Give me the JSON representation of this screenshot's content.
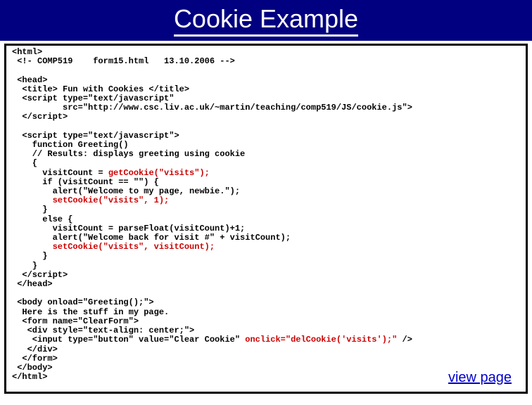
{
  "title": "Cookie Example",
  "link": "view page",
  "code": {
    "l1": "<html>",
    "l2": " <!- COMP519    form15.html   13.10.2006 -->",
    "l3": "",
    "l4": " <head>",
    "l5": "  <title> Fun with Cookies </title>",
    "l6": "  <script type=\"text/javascript\"",
    "l7": "          src=\"http://www.csc.liv.ac.uk/~martin/teaching/comp519/JS/cookie.js\">",
    "l8": "  </script>",
    "l9": "",
    "l10": "  <script type=\"text/javascript\">",
    "l11": "    function Greeting()",
    "l12": "    // Results: displays greeting using cookie",
    "l13": "    {",
    "l14": "      visitCount = ",
    "l14r": "getCookie(\"visits\");",
    "l15": "      if (visitCount == \"\") {",
    "l16": "        alert(\"Welcome to my page, newbie.\");",
    "l17a": "        ",
    "l17r": "setCookie(\"visits\", 1);",
    "l18": "      }",
    "l19": "      else {",
    "l20": "        visitCount = parseFloat(visitCount)+1;",
    "l21": "        alert(\"Welcome back for visit #\" + visitCount);",
    "l22a": "        ",
    "l22r": "setCookie(\"visits\", visitCount);",
    "l23": "      }",
    "l24": "    }",
    "l25": "  </script>",
    "l26": " </head>",
    "l27": "",
    "l28": " <body onload=\"Greeting();\">",
    "l29": "  Here is the stuff in my page.",
    "l30": "  <form name=\"ClearForm\">",
    "l31": "   <div style=\"text-align: center;\">",
    "l32a": "    <input type=\"button\" value=\"Clear Cookie\" ",
    "l32r": "onclick=\"delCookie('visits');\"",
    "l32b": " />",
    "l33": "   </div>",
    "l34": "  </form>",
    "l35": " </body>",
    "l36": "</html>"
  }
}
